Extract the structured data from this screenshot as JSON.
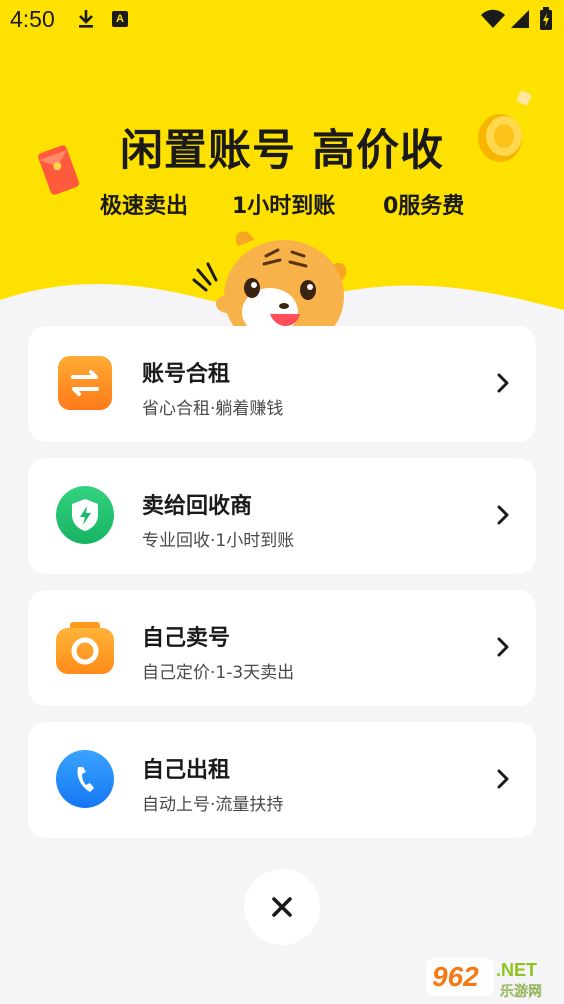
{
  "status_bar": {
    "time": "4:50",
    "notification_icons": [
      "download-icon",
      "a-icon"
    ],
    "a_icon_text": "A",
    "right_icons": [
      "wifi-icon",
      "signal-icon",
      "battery-icon"
    ]
  },
  "hero": {
    "title": "闲置账号 高价收",
    "features": [
      "极速卖出",
      "1小时到账",
      "0服务费"
    ]
  },
  "menu": [
    {
      "title": "账号合租",
      "desc": "省心合租·躺着赚钱",
      "icon": "swap-icon",
      "color": "#ff8a1f"
    },
    {
      "title": "卖给回收商",
      "desc": "专业回收·1小时到账",
      "icon": "shield-bolt-icon",
      "color": "#22c372"
    },
    {
      "title": "自己卖号",
      "desc": "自己定价·1-3天卖出",
      "icon": "camera-icon",
      "color": "#ff9f1a"
    },
    {
      "title": "自己出租",
      "desc": "自动上号·流量扶持",
      "icon": "phone-icon",
      "color": "#1e90ff"
    }
  ],
  "close_icon": "close-icon",
  "watermark": {
    "brand": "962",
    "suffix": ".NET",
    "sub": "乐游网"
  },
  "colors": {
    "hero_bg": "#ffe100",
    "page_bg": "#f5f5f7"
  }
}
